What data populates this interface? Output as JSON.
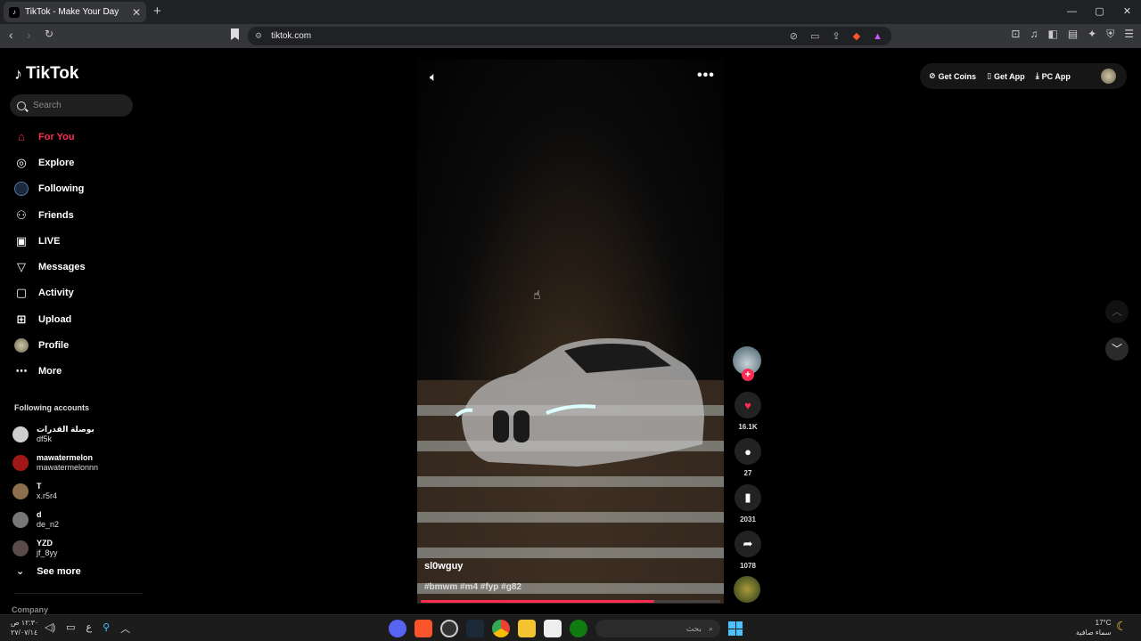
{
  "browser": {
    "tab_title": "TikTok - Make Your Day",
    "tab_close": "✕",
    "new_tab": "+",
    "url": "tiktok.com",
    "window_controls": [
      "—",
      "▢",
      "✕"
    ]
  },
  "sidebar": {
    "logo": "TikTok",
    "search_placeholder": "Search",
    "nav": [
      {
        "label": "For You",
        "icon": "home-icon",
        "glyph": "⌂"
      },
      {
        "label": "Explore",
        "icon": "compass-icon",
        "glyph": "◎"
      },
      {
        "label": "Following",
        "icon": "following-avatar-icon",
        "glyph": ""
      },
      {
        "label": "Friends",
        "icon": "friends-icon",
        "glyph": "⚇"
      },
      {
        "label": "LIVE",
        "icon": "live-icon",
        "glyph": "▣"
      },
      {
        "label": "Messages",
        "icon": "messages-icon",
        "glyph": "▽"
      },
      {
        "label": "Activity",
        "icon": "activity-icon",
        "glyph": "▢"
      },
      {
        "label": "Upload",
        "icon": "upload-icon",
        "glyph": "⊞"
      },
      {
        "label": "Profile",
        "icon": "profile-avatar-icon",
        "glyph": ""
      },
      {
        "label": "More",
        "icon": "more-icon",
        "glyph": "⋯"
      }
    ],
    "following_title": "Following accounts",
    "following": [
      {
        "name": "بوصلة القدرات",
        "handle": "df5k",
        "color": "#cfcfcf"
      },
      {
        "name": "mawatermelon",
        "handle": "mawatermelonnn",
        "color": "#a01818"
      },
      {
        "name": "T",
        "handle": "x.r5r4",
        "color": "#8b6f4e"
      },
      {
        "name": "d",
        "handle": "de_n2",
        "color": "#777777"
      },
      {
        "name": "YZD",
        "handle": "jf_8yy",
        "color": "#5a4a4a"
      }
    ],
    "see_more": "See more",
    "company": "Company"
  },
  "video": {
    "author": "sl0wguy",
    "tags": "#bmwm #m4 #fyp #g82",
    "progress": 0.78
  },
  "actions": {
    "likes": "16.1K",
    "comments": "27",
    "saves": "2031",
    "shares": "1078"
  },
  "topright": {
    "get_coins": "Get Coins",
    "get_app": "Get App",
    "pc_app": "PC App"
  },
  "taskbar": {
    "time": "١٢:٣٠ ص",
    "date": "٢٧/٠٧/١٤",
    "search_text": "بحث",
    "temperature": "17°C",
    "weather": "سماء صافية",
    "lang": "ع"
  }
}
